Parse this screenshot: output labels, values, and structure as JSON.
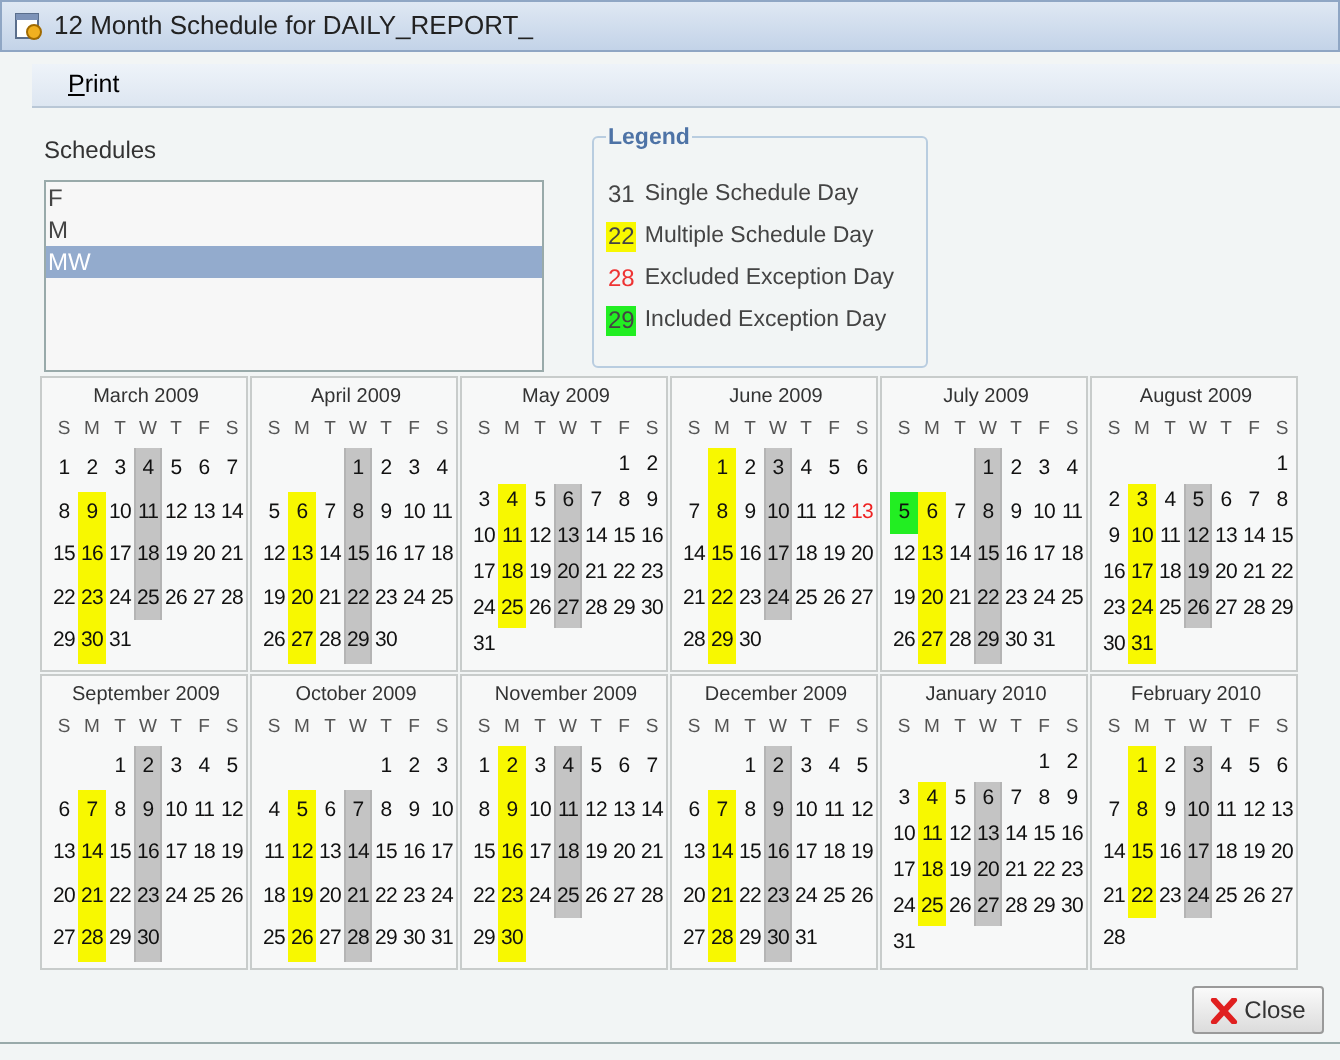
{
  "window": {
    "title": "12 Month Schedule for DAILY_REPORT_"
  },
  "menu": [
    {
      "label": "Print"
    }
  ],
  "schedules": {
    "label": "Schedules",
    "items": [
      {
        "label": "F",
        "selected": false
      },
      {
        "label": "M",
        "selected": false
      },
      {
        "label": "MW",
        "selected": true
      }
    ]
  },
  "legend": {
    "title": "Legend",
    "items": [
      {
        "sample": "31",
        "label": "Single Schedule Day",
        "kind": "plain"
      },
      {
        "sample": "22",
        "label": "Multiple Schedule Day",
        "kind": "multiple"
      },
      {
        "sample": "28",
        "label": "Excluded Exception Day",
        "kind": "excluded"
      },
      {
        "sample": "29",
        "label": "Included Exception Day",
        "kind": "included"
      }
    ]
  },
  "months": [
    {
      "title": "March 2009",
      "weekdays": [
        "S",
        "M",
        "T",
        "W",
        "T",
        "F",
        "S"
      ],
      "weeks": [
        [
          {
            "day": "1",
            "kind": "plain"
          },
          {
            "day": "2",
            "kind": "plain"
          },
          {
            "day": "3",
            "kind": "plain"
          },
          {
            "day": "4",
            "kind": "selected"
          },
          {
            "day": "5",
            "kind": "plain"
          },
          {
            "day": "6",
            "kind": "plain"
          },
          {
            "day": "7",
            "kind": "plain"
          }
        ],
        [
          {
            "day": "8",
            "kind": "plain"
          },
          {
            "day": "9",
            "kind": "multiple"
          },
          {
            "day": "10",
            "kind": "plain"
          },
          {
            "day": "11",
            "kind": "selected"
          },
          {
            "day": "12",
            "kind": "plain"
          },
          {
            "day": "13",
            "kind": "plain"
          },
          {
            "day": "14",
            "kind": "plain"
          }
        ],
        [
          {
            "day": "15",
            "kind": "plain"
          },
          {
            "day": "16",
            "kind": "multiple"
          },
          {
            "day": "17",
            "kind": "plain"
          },
          {
            "day": "18",
            "kind": "selected"
          },
          {
            "day": "19",
            "kind": "plain"
          },
          {
            "day": "20",
            "kind": "plain"
          },
          {
            "day": "21",
            "kind": "plain"
          }
        ],
        [
          {
            "day": "22",
            "kind": "plain"
          },
          {
            "day": "23",
            "kind": "multiple"
          },
          {
            "day": "24",
            "kind": "plain"
          },
          {
            "day": "25",
            "kind": "selected"
          },
          {
            "day": "26",
            "kind": "plain"
          },
          {
            "day": "27",
            "kind": "plain"
          },
          {
            "day": "28",
            "kind": "plain"
          }
        ],
        [
          {
            "day": "29",
            "kind": "plain"
          },
          {
            "day": "30",
            "kind": "multiple"
          },
          {
            "day": "31",
            "kind": "plain"
          }
        ]
      ]
    },
    {
      "title": "April 2009",
      "weekdays": [
        "S",
        "M",
        "T",
        "W",
        "T",
        "F",
        "S"
      ],
      "weeks": [
        [
          {
            "day": "1",
            "kind": "selected"
          },
          {
            "day": "2",
            "kind": "plain"
          },
          {
            "day": "3",
            "kind": "plain"
          },
          {
            "day": "4",
            "kind": "plain"
          }
        ],
        [
          {
            "day": "5",
            "kind": "plain"
          },
          {
            "day": "6",
            "kind": "multiple"
          },
          {
            "day": "7",
            "kind": "plain"
          },
          {
            "day": "8",
            "kind": "selected"
          },
          {
            "day": "9",
            "kind": "plain"
          },
          {
            "day": "10",
            "kind": "plain"
          },
          {
            "day": "11",
            "kind": "plain"
          }
        ],
        [
          {
            "day": "12",
            "kind": "plain"
          },
          {
            "day": "13",
            "kind": "multiple"
          },
          {
            "day": "14",
            "kind": "plain"
          },
          {
            "day": "15",
            "kind": "selected"
          },
          {
            "day": "16",
            "kind": "plain"
          },
          {
            "day": "17",
            "kind": "plain"
          },
          {
            "day": "18",
            "kind": "plain"
          }
        ],
        [
          {
            "day": "19",
            "kind": "plain"
          },
          {
            "day": "20",
            "kind": "multiple"
          },
          {
            "day": "21",
            "kind": "plain"
          },
          {
            "day": "22",
            "kind": "selected"
          },
          {
            "day": "23",
            "kind": "plain"
          },
          {
            "day": "24",
            "kind": "plain"
          },
          {
            "day": "25",
            "kind": "plain"
          }
        ],
        [
          {
            "day": "26",
            "kind": "plain"
          },
          {
            "day": "27",
            "kind": "multiple"
          },
          {
            "day": "28",
            "kind": "plain"
          },
          {
            "day": "29",
            "kind": "selected"
          },
          {
            "day": "30",
            "kind": "plain"
          }
        ]
      ]
    },
    {
      "title": "May 2009",
      "weekdays": [
        "S",
        "M",
        "T",
        "W",
        "T",
        "F",
        "S"
      ],
      "weeks": [
        [
          {
            "day": "1",
            "kind": "plain"
          },
          {
            "day": "2",
            "kind": "plain"
          }
        ],
        [
          {
            "day": "3",
            "kind": "plain"
          },
          {
            "day": "4",
            "kind": "multiple"
          },
          {
            "day": "5",
            "kind": "plain"
          },
          {
            "day": "6",
            "kind": "selected"
          },
          {
            "day": "7",
            "kind": "plain"
          },
          {
            "day": "8",
            "kind": "plain"
          },
          {
            "day": "9",
            "kind": "plain"
          }
        ],
        [
          {
            "day": "10",
            "kind": "plain"
          },
          {
            "day": "11",
            "kind": "multiple"
          },
          {
            "day": "12",
            "kind": "plain"
          },
          {
            "day": "13",
            "kind": "selected"
          },
          {
            "day": "14",
            "kind": "plain"
          },
          {
            "day": "15",
            "kind": "plain"
          },
          {
            "day": "16",
            "kind": "plain"
          }
        ],
        [
          {
            "day": "17",
            "kind": "plain"
          },
          {
            "day": "18",
            "kind": "multiple"
          },
          {
            "day": "19",
            "kind": "plain"
          },
          {
            "day": "20",
            "kind": "selected"
          },
          {
            "day": "21",
            "kind": "plain"
          },
          {
            "day": "22",
            "kind": "plain"
          },
          {
            "day": "23",
            "kind": "plain"
          }
        ],
        [
          {
            "day": "24",
            "kind": "plain"
          },
          {
            "day": "25",
            "kind": "multiple"
          },
          {
            "day": "26",
            "kind": "plain"
          },
          {
            "day": "27",
            "kind": "selected"
          },
          {
            "day": "28",
            "kind": "plain"
          },
          {
            "day": "29",
            "kind": "plain"
          },
          {
            "day": "30",
            "kind": "plain"
          }
        ],
        [
          {
            "day": "31",
            "kind": "plain"
          }
        ]
      ]
    },
    {
      "title": "June 2009",
      "weekdays": [
        "S",
        "M",
        "T",
        "W",
        "T",
        "F",
        "S"
      ],
      "weeks": [
        [
          {
            "day": "1",
            "kind": "multiple"
          },
          {
            "day": "2",
            "kind": "plain"
          },
          {
            "day": "3",
            "kind": "selected"
          },
          {
            "day": "4",
            "kind": "plain"
          },
          {
            "day": "5",
            "kind": "plain"
          },
          {
            "day": "6",
            "kind": "plain"
          }
        ],
        [
          {
            "day": "7",
            "kind": "plain"
          },
          {
            "day": "8",
            "kind": "multiple"
          },
          {
            "day": "9",
            "kind": "plain"
          },
          {
            "day": "10",
            "kind": "selected"
          },
          {
            "day": "11",
            "kind": "plain"
          },
          {
            "day": "12",
            "kind": "plain"
          },
          {
            "day": "13",
            "kind": "excluded"
          }
        ],
        [
          {
            "day": "14",
            "kind": "plain"
          },
          {
            "day": "15",
            "kind": "multiple"
          },
          {
            "day": "16",
            "kind": "plain"
          },
          {
            "day": "17",
            "kind": "selected"
          },
          {
            "day": "18",
            "kind": "plain"
          },
          {
            "day": "19",
            "kind": "plain"
          },
          {
            "day": "20",
            "kind": "plain"
          }
        ],
        [
          {
            "day": "21",
            "kind": "plain"
          },
          {
            "day": "22",
            "kind": "multiple"
          },
          {
            "day": "23",
            "kind": "plain"
          },
          {
            "day": "24",
            "kind": "selected"
          },
          {
            "day": "25",
            "kind": "plain"
          },
          {
            "day": "26",
            "kind": "plain"
          },
          {
            "day": "27",
            "kind": "plain"
          }
        ],
        [
          {
            "day": "28",
            "kind": "plain"
          },
          {
            "day": "29",
            "kind": "multiple"
          },
          {
            "day": "30",
            "kind": "plain"
          }
        ]
      ]
    },
    {
      "title": "July 2009",
      "weekdays": [
        "S",
        "M",
        "T",
        "W",
        "T",
        "F",
        "S"
      ],
      "weeks": [
        [
          {
            "day": "1",
            "kind": "selected"
          },
          {
            "day": "2",
            "kind": "plain"
          },
          {
            "day": "3",
            "kind": "plain"
          },
          {
            "day": "4",
            "kind": "plain"
          }
        ],
        [
          {
            "day": "5",
            "kind": "included"
          },
          {
            "day": "6",
            "kind": "multiple"
          },
          {
            "day": "7",
            "kind": "plain"
          },
          {
            "day": "8",
            "kind": "selected"
          },
          {
            "day": "9",
            "kind": "plain"
          },
          {
            "day": "10",
            "kind": "plain"
          },
          {
            "day": "11",
            "kind": "plain"
          }
        ],
        [
          {
            "day": "12",
            "kind": "plain"
          },
          {
            "day": "13",
            "kind": "multiple"
          },
          {
            "day": "14",
            "kind": "plain"
          },
          {
            "day": "15",
            "kind": "selected"
          },
          {
            "day": "16",
            "kind": "plain"
          },
          {
            "day": "17",
            "kind": "plain"
          },
          {
            "day": "18",
            "kind": "plain"
          }
        ],
        [
          {
            "day": "19",
            "kind": "plain"
          },
          {
            "day": "20",
            "kind": "multiple"
          },
          {
            "day": "21",
            "kind": "plain"
          },
          {
            "day": "22",
            "kind": "selected"
          },
          {
            "day": "23",
            "kind": "plain"
          },
          {
            "day": "24",
            "kind": "plain"
          },
          {
            "day": "25",
            "kind": "plain"
          }
        ],
        [
          {
            "day": "26",
            "kind": "plain"
          },
          {
            "day": "27",
            "kind": "multiple"
          },
          {
            "day": "28",
            "kind": "plain"
          },
          {
            "day": "29",
            "kind": "selected"
          },
          {
            "day": "30",
            "kind": "plain"
          },
          {
            "day": "31",
            "kind": "plain"
          }
        ]
      ]
    },
    {
      "title": "August 2009",
      "weekdays": [
        "S",
        "M",
        "T",
        "W",
        "T",
        "F",
        "S"
      ],
      "weeks": [
        [
          {
            "day": "1",
            "kind": "plain"
          }
        ],
        [
          {
            "day": "2",
            "kind": "plain"
          },
          {
            "day": "3",
            "kind": "multiple"
          },
          {
            "day": "4",
            "kind": "plain"
          },
          {
            "day": "5",
            "kind": "selected"
          },
          {
            "day": "6",
            "kind": "plain"
          },
          {
            "day": "7",
            "kind": "plain"
          },
          {
            "day": "8",
            "kind": "plain"
          }
        ],
        [
          {
            "day": "9",
            "kind": "plain"
          },
          {
            "day": "10",
            "kind": "multiple"
          },
          {
            "day": "11",
            "kind": "plain"
          },
          {
            "day": "12",
            "kind": "selected"
          },
          {
            "day": "13",
            "kind": "plain"
          },
          {
            "day": "14",
            "kind": "plain"
          },
          {
            "day": "15",
            "kind": "plain"
          }
        ],
        [
          {
            "day": "16",
            "kind": "plain"
          },
          {
            "day": "17",
            "kind": "multiple"
          },
          {
            "day": "18",
            "kind": "plain"
          },
          {
            "day": "19",
            "kind": "selected"
          },
          {
            "day": "20",
            "kind": "plain"
          },
          {
            "day": "21",
            "kind": "plain"
          },
          {
            "day": "22",
            "kind": "plain"
          }
        ],
        [
          {
            "day": "23",
            "kind": "plain"
          },
          {
            "day": "24",
            "kind": "multiple"
          },
          {
            "day": "25",
            "kind": "plain"
          },
          {
            "day": "26",
            "kind": "selected"
          },
          {
            "day": "27",
            "kind": "plain"
          },
          {
            "day": "28",
            "kind": "plain"
          },
          {
            "day": "29",
            "kind": "plain"
          }
        ],
        [
          {
            "day": "30",
            "kind": "plain"
          },
          {
            "day": "31",
            "kind": "multiple"
          }
        ]
      ]
    },
    {
      "title": "September 2009",
      "weekdays": [
        "S",
        "M",
        "T",
        "W",
        "T",
        "F",
        "S"
      ],
      "weeks": [
        [
          {
            "day": "1",
            "kind": "plain"
          },
          {
            "day": "2",
            "kind": "selected"
          },
          {
            "day": "3",
            "kind": "plain"
          },
          {
            "day": "4",
            "kind": "plain"
          },
          {
            "day": "5",
            "kind": "plain"
          }
        ],
        [
          {
            "day": "6",
            "kind": "plain"
          },
          {
            "day": "7",
            "kind": "multiple"
          },
          {
            "day": "8",
            "kind": "plain"
          },
          {
            "day": "9",
            "kind": "selected"
          },
          {
            "day": "10",
            "kind": "plain"
          },
          {
            "day": "11",
            "kind": "plain"
          },
          {
            "day": "12",
            "kind": "plain"
          }
        ],
        [
          {
            "day": "13",
            "kind": "plain"
          },
          {
            "day": "14",
            "kind": "multiple"
          },
          {
            "day": "15",
            "kind": "plain"
          },
          {
            "day": "16",
            "kind": "selected"
          },
          {
            "day": "17",
            "kind": "plain"
          },
          {
            "day": "18",
            "kind": "plain"
          },
          {
            "day": "19",
            "kind": "plain"
          }
        ],
        [
          {
            "day": "20",
            "kind": "plain"
          },
          {
            "day": "21",
            "kind": "multiple"
          },
          {
            "day": "22",
            "kind": "plain"
          },
          {
            "day": "23",
            "kind": "selected"
          },
          {
            "day": "24",
            "kind": "plain"
          },
          {
            "day": "25",
            "kind": "plain"
          },
          {
            "day": "26",
            "kind": "plain"
          }
        ],
        [
          {
            "day": "27",
            "kind": "plain"
          },
          {
            "day": "28",
            "kind": "multiple"
          },
          {
            "day": "29",
            "kind": "plain"
          },
          {
            "day": "30",
            "kind": "selected"
          }
        ]
      ]
    },
    {
      "title": "October 2009",
      "weekdays": [
        "S",
        "M",
        "T",
        "W",
        "T",
        "F",
        "S"
      ],
      "weeks": [
        [
          {
            "day": "1",
            "kind": "plain"
          },
          {
            "day": "2",
            "kind": "plain"
          },
          {
            "day": "3",
            "kind": "plain"
          }
        ],
        [
          {
            "day": "4",
            "kind": "plain"
          },
          {
            "day": "5",
            "kind": "multiple"
          },
          {
            "day": "6",
            "kind": "plain"
          },
          {
            "day": "7",
            "kind": "selected"
          },
          {
            "day": "8",
            "kind": "plain"
          },
          {
            "day": "9",
            "kind": "plain"
          },
          {
            "day": "10",
            "kind": "plain"
          }
        ],
        [
          {
            "day": "11",
            "kind": "plain"
          },
          {
            "day": "12",
            "kind": "multiple"
          },
          {
            "day": "13",
            "kind": "plain"
          },
          {
            "day": "14",
            "kind": "selected"
          },
          {
            "day": "15",
            "kind": "plain"
          },
          {
            "day": "16",
            "kind": "plain"
          },
          {
            "day": "17",
            "kind": "plain"
          }
        ],
        [
          {
            "day": "18",
            "kind": "plain"
          },
          {
            "day": "19",
            "kind": "multiple"
          },
          {
            "day": "20",
            "kind": "plain"
          },
          {
            "day": "21",
            "kind": "selected"
          },
          {
            "day": "22",
            "kind": "plain"
          },
          {
            "day": "23",
            "kind": "plain"
          },
          {
            "day": "24",
            "kind": "plain"
          }
        ],
        [
          {
            "day": "25",
            "kind": "plain"
          },
          {
            "day": "26",
            "kind": "multiple"
          },
          {
            "day": "27",
            "kind": "plain"
          },
          {
            "day": "28",
            "kind": "selected"
          },
          {
            "day": "29",
            "kind": "plain"
          },
          {
            "day": "30",
            "kind": "plain"
          },
          {
            "day": "31",
            "kind": "plain"
          }
        ]
      ]
    },
    {
      "title": "November 2009",
      "weekdays": [
        "S",
        "M",
        "T",
        "W",
        "T",
        "F",
        "S"
      ],
      "weeks": [
        [
          {
            "day": "1",
            "kind": "plain"
          },
          {
            "day": "2",
            "kind": "multiple"
          },
          {
            "day": "3",
            "kind": "plain"
          },
          {
            "day": "4",
            "kind": "selected"
          },
          {
            "day": "5",
            "kind": "plain"
          },
          {
            "day": "6",
            "kind": "plain"
          },
          {
            "day": "7",
            "kind": "plain"
          }
        ],
        [
          {
            "day": "8",
            "kind": "plain"
          },
          {
            "day": "9",
            "kind": "multiple"
          },
          {
            "day": "10",
            "kind": "plain"
          },
          {
            "day": "11",
            "kind": "selected"
          },
          {
            "day": "12",
            "kind": "plain"
          },
          {
            "day": "13",
            "kind": "plain"
          },
          {
            "day": "14",
            "kind": "plain"
          }
        ],
        [
          {
            "day": "15",
            "kind": "plain"
          },
          {
            "day": "16",
            "kind": "multiple"
          },
          {
            "day": "17",
            "kind": "plain"
          },
          {
            "day": "18",
            "kind": "selected"
          },
          {
            "day": "19",
            "kind": "plain"
          },
          {
            "day": "20",
            "kind": "plain"
          },
          {
            "day": "21",
            "kind": "plain"
          }
        ],
        [
          {
            "day": "22",
            "kind": "plain"
          },
          {
            "day": "23",
            "kind": "multiple"
          },
          {
            "day": "24",
            "kind": "plain"
          },
          {
            "day": "25",
            "kind": "selected"
          },
          {
            "day": "26",
            "kind": "plain"
          },
          {
            "day": "27",
            "kind": "plain"
          },
          {
            "day": "28",
            "kind": "plain"
          }
        ],
        [
          {
            "day": "29",
            "kind": "plain"
          },
          {
            "day": "30",
            "kind": "multiple"
          }
        ]
      ]
    },
    {
      "title": "December 2009",
      "weekdays": [
        "S",
        "M",
        "T",
        "W",
        "T",
        "F",
        "S"
      ],
      "weeks": [
        [
          {
            "day": "1",
            "kind": "plain"
          },
          {
            "day": "2",
            "kind": "selected"
          },
          {
            "day": "3",
            "kind": "plain"
          },
          {
            "day": "4",
            "kind": "plain"
          },
          {
            "day": "5",
            "kind": "plain"
          }
        ],
        [
          {
            "day": "6",
            "kind": "plain"
          },
          {
            "day": "7",
            "kind": "multiple"
          },
          {
            "day": "8",
            "kind": "plain"
          },
          {
            "day": "9",
            "kind": "selected"
          },
          {
            "day": "10",
            "kind": "plain"
          },
          {
            "day": "11",
            "kind": "plain"
          },
          {
            "day": "12",
            "kind": "plain"
          }
        ],
        [
          {
            "day": "13",
            "kind": "plain"
          },
          {
            "day": "14",
            "kind": "multiple"
          },
          {
            "day": "15",
            "kind": "plain"
          },
          {
            "day": "16",
            "kind": "selected"
          },
          {
            "day": "17",
            "kind": "plain"
          },
          {
            "day": "18",
            "kind": "plain"
          },
          {
            "day": "19",
            "kind": "plain"
          }
        ],
        [
          {
            "day": "20",
            "kind": "plain"
          },
          {
            "day": "21",
            "kind": "multiple"
          },
          {
            "day": "22",
            "kind": "plain"
          },
          {
            "day": "23",
            "kind": "selected"
          },
          {
            "day": "24",
            "kind": "plain"
          },
          {
            "day": "25",
            "kind": "plain"
          },
          {
            "day": "26",
            "kind": "plain"
          }
        ],
        [
          {
            "day": "27",
            "kind": "plain"
          },
          {
            "day": "28",
            "kind": "multiple"
          },
          {
            "day": "29",
            "kind": "plain"
          },
          {
            "day": "30",
            "kind": "selected"
          },
          {
            "day": "31",
            "kind": "plain"
          }
        ]
      ]
    },
    {
      "title": "January 2010",
      "weekdays": [
        "S",
        "M",
        "T",
        "W",
        "T",
        "F",
        "S"
      ],
      "weeks": [
        [
          {
            "day": "1",
            "kind": "plain"
          },
          {
            "day": "2",
            "kind": "plain"
          }
        ],
        [
          {
            "day": "3",
            "kind": "plain"
          },
          {
            "day": "4",
            "kind": "multiple"
          },
          {
            "day": "5",
            "kind": "plain"
          },
          {
            "day": "6",
            "kind": "selected"
          },
          {
            "day": "7",
            "kind": "plain"
          },
          {
            "day": "8",
            "kind": "plain"
          },
          {
            "day": "9",
            "kind": "plain"
          }
        ],
        [
          {
            "day": "10",
            "kind": "plain"
          },
          {
            "day": "11",
            "kind": "multiple"
          },
          {
            "day": "12",
            "kind": "plain"
          },
          {
            "day": "13",
            "kind": "selected"
          },
          {
            "day": "14",
            "kind": "plain"
          },
          {
            "day": "15",
            "kind": "plain"
          },
          {
            "day": "16",
            "kind": "plain"
          }
        ],
        [
          {
            "day": "17",
            "kind": "plain"
          },
          {
            "day": "18",
            "kind": "multiple"
          },
          {
            "day": "19",
            "kind": "plain"
          },
          {
            "day": "20",
            "kind": "selected"
          },
          {
            "day": "21",
            "kind": "plain"
          },
          {
            "day": "22",
            "kind": "plain"
          },
          {
            "day": "23",
            "kind": "plain"
          }
        ],
        [
          {
            "day": "24",
            "kind": "plain"
          },
          {
            "day": "25",
            "kind": "multiple"
          },
          {
            "day": "26",
            "kind": "plain"
          },
          {
            "day": "27",
            "kind": "selected"
          },
          {
            "day": "28",
            "kind": "plain"
          },
          {
            "day": "29",
            "kind": "plain"
          },
          {
            "day": "30",
            "kind": "plain"
          }
        ],
        [
          {
            "day": "31",
            "kind": "plain"
          }
        ]
      ]
    },
    {
      "title": "February 2010",
      "weekdays": [
        "S",
        "M",
        "T",
        "W",
        "T",
        "F",
        "S"
      ],
      "weeks": [
        [
          {
            "day": "1",
            "kind": "multiple"
          },
          {
            "day": "2",
            "kind": "plain"
          },
          {
            "day": "3",
            "kind": "selected"
          },
          {
            "day": "4",
            "kind": "plain"
          },
          {
            "day": "5",
            "kind": "plain"
          },
          {
            "day": "6",
            "kind": "plain"
          }
        ],
        [
          {
            "day": "7",
            "kind": "plain"
          },
          {
            "day": "8",
            "kind": "multiple"
          },
          {
            "day": "9",
            "kind": "plain"
          },
          {
            "day": "10",
            "kind": "selected"
          },
          {
            "day": "11",
            "kind": "plain"
          },
          {
            "day": "12",
            "kind": "plain"
          },
          {
            "day": "13",
            "kind": "plain"
          }
        ],
        [
          {
            "day": "14",
            "kind": "plain"
          },
          {
            "day": "15",
            "kind": "multiple"
          },
          {
            "day": "16",
            "kind": "plain"
          },
          {
            "day": "17",
            "kind": "selected"
          },
          {
            "day": "18",
            "kind": "plain"
          },
          {
            "day": "19",
            "kind": "plain"
          },
          {
            "day": "20",
            "kind": "plain"
          }
        ],
        [
          {
            "day": "21",
            "kind": "plain"
          },
          {
            "day": "22",
            "kind": "multiple"
          },
          {
            "day": "23",
            "kind": "plain"
          },
          {
            "day": "24",
            "kind": "selected"
          },
          {
            "day": "25",
            "kind": "plain"
          },
          {
            "day": "26",
            "kind": "plain"
          },
          {
            "day": "27",
            "kind": "plain"
          }
        ],
        [
          {
            "day": "28",
            "kind": "plain"
          }
        ]
      ]
    }
  ],
  "buttons": [
    {
      "label": "Close"
    }
  ]
}
